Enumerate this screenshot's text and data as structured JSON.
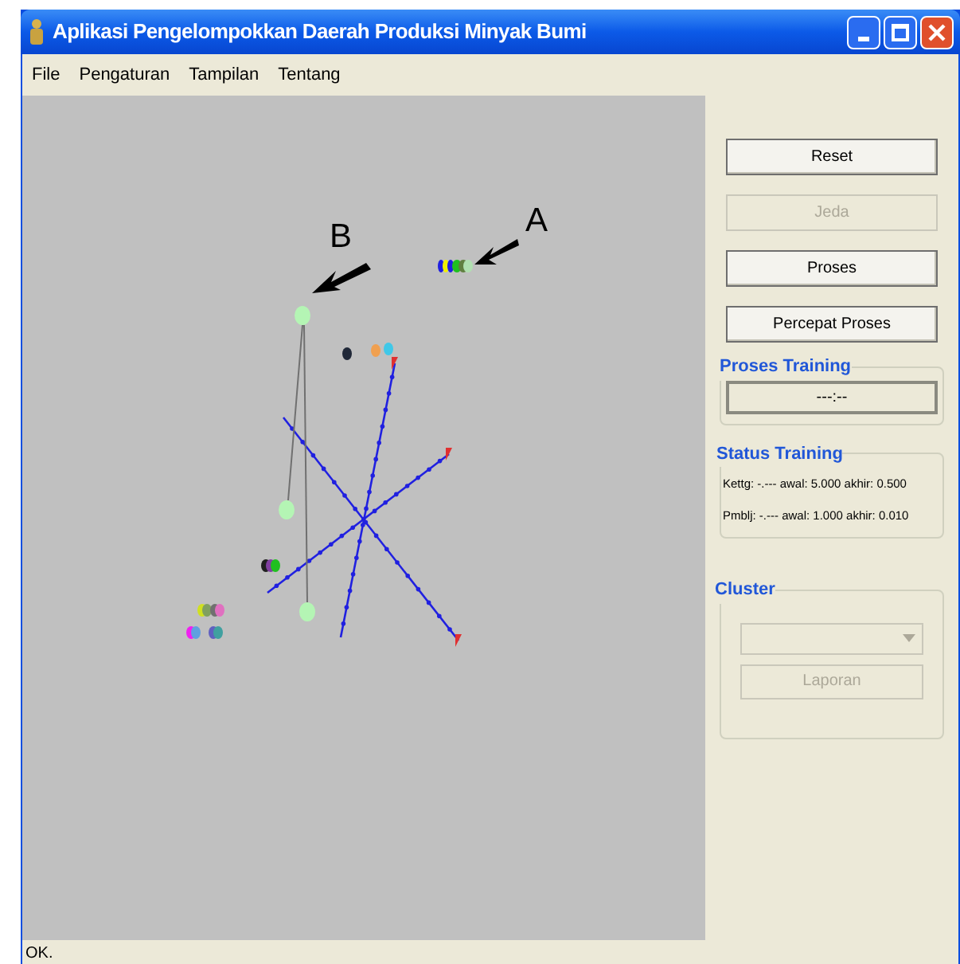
{
  "window": {
    "title": "Aplikasi Pengelompokkan Daerah Produksi Minyak Bumi"
  },
  "menu": [
    {
      "label": "File"
    },
    {
      "label": "Pengaturan"
    },
    {
      "label": "Tampilan"
    },
    {
      "label": "Tentang"
    }
  ],
  "plot": {
    "labels": [
      {
        "text": "A",
        "kind": "a"
      },
      {
        "text": "B",
        "kind": "b"
      }
    ]
  },
  "buttons": [
    {
      "label": "Reset",
      "disabled": false
    },
    {
      "label": "Jeda",
      "disabled": true
    },
    {
      "label": "Proses",
      "disabled": false
    },
    {
      "label": "Percepat Proses",
      "disabled": false
    }
  ],
  "proses_training": {
    "title": "Proses Training",
    "value": "---:--"
  },
  "status_training": {
    "title": "Status Training",
    "lines": [
      "Kettg: -.--- awal: 5.000 akhir: 0.500",
      "Pmblj: -.--- awal: 1.000 akhir: 0.010"
    ]
  },
  "cluster": {
    "title": "Cluster",
    "dropdown_disabled": true,
    "button": {
      "label": "Laporan",
      "disabled": true
    }
  },
  "status_bar": "OK."
}
